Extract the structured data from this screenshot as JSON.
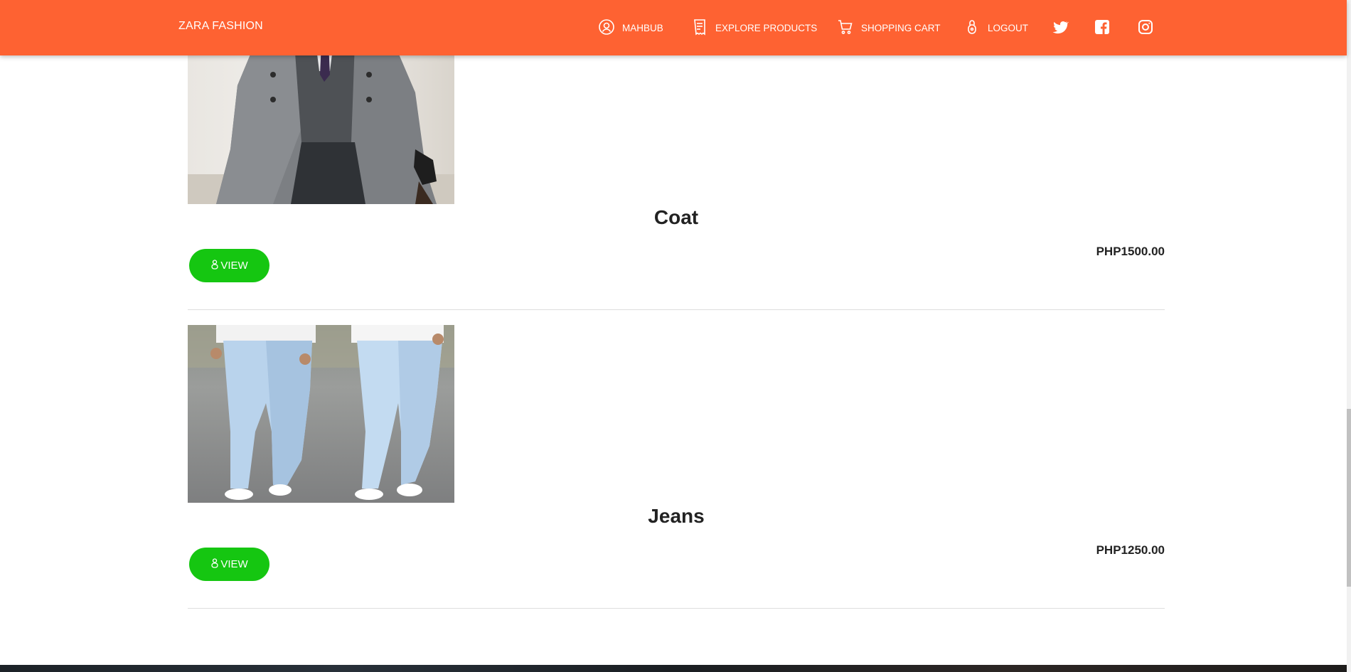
{
  "header": {
    "brand": "ZARA FASHION",
    "nav": {
      "user": "MAHBUB",
      "explore": "EXPLORE PRODUCTS",
      "cart": "SHOPPING CART",
      "logout": "LOGOUT"
    },
    "social_icons": [
      "twitter-icon",
      "facebook-icon",
      "instagram-icon"
    ]
  },
  "products": [
    {
      "name": "Coat",
      "price": "PHP1500.00",
      "view_label": "VIEW",
      "image_icon": "coat-photo"
    },
    {
      "name": "Jeans",
      "price": "PHP1250.00",
      "view_label": "VIEW",
      "image_icon": "jeans-photo"
    }
  ],
  "colors": {
    "header_bg": "#fe6232",
    "view_button_bg": "#15c611",
    "text_dark": "#222222"
  }
}
